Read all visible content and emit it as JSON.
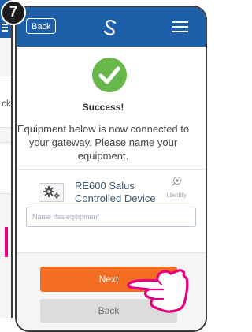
{
  "step_number": "7",
  "header": {
    "back_label": "Back",
    "logo": "salus-swoosh-logo",
    "menu_icon": "hamburger-menu-icon"
  },
  "status": {
    "icon": "check-circle-icon",
    "title": "Success!",
    "message": "Equipment below is now connected to your gateway. Please name your equipment."
  },
  "device": {
    "icon": "gear-icon",
    "name": "RE600 Salus Controlled Device",
    "identify_label": "Identify",
    "identify_icon": "identify-icon"
  },
  "name_input": {
    "placeholder": "Name this equipment",
    "value": ""
  },
  "actions": {
    "next_label": "Next",
    "back_label": "Back"
  },
  "left_phone": {
    "partial_text": "ck"
  },
  "colors": {
    "header": "#1d5fa8",
    "success": "#68b74a",
    "next_button": "#f26d21",
    "back_button": "#dcdcdc",
    "pointer_hand": "#e6007e"
  }
}
